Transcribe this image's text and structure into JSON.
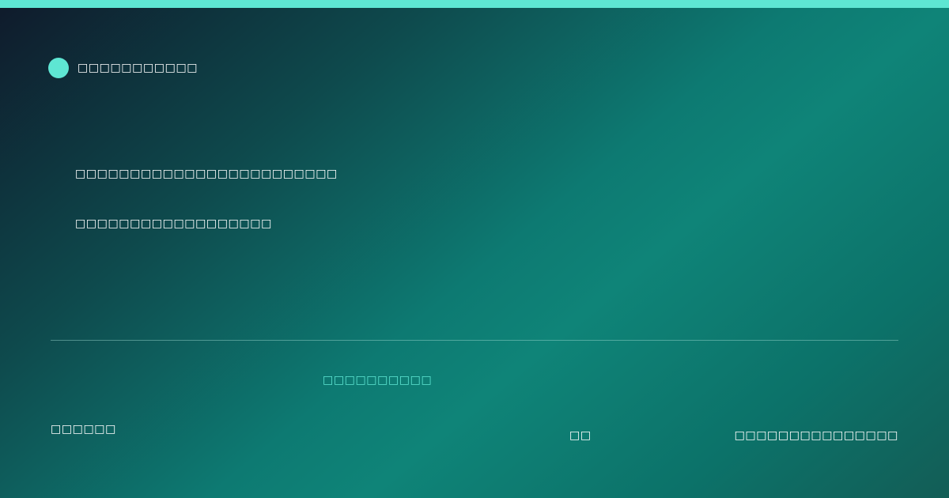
{
  "brand": {
    "name": "□□□□□□□□□□□",
    "dot_color": "#5ee6d3"
  },
  "headline": {
    "line1": "□□□□□□□□□□□□□□□□□□□□□□□□",
    "line2": "□□□□□□□□□□□□□□□□□□"
  },
  "tagline": "□□□□□□□□□□",
  "footer": {
    "left": "□□□□□□",
    "middle": "□□",
    "right": "□□□□□□□□□□□□□□□"
  },
  "colors": {
    "accent": "#5ee6d3",
    "text": "#ffffff",
    "background_start": "#0f1a2b",
    "background_mid": "#0f8478",
    "background_end": "#135d56"
  }
}
